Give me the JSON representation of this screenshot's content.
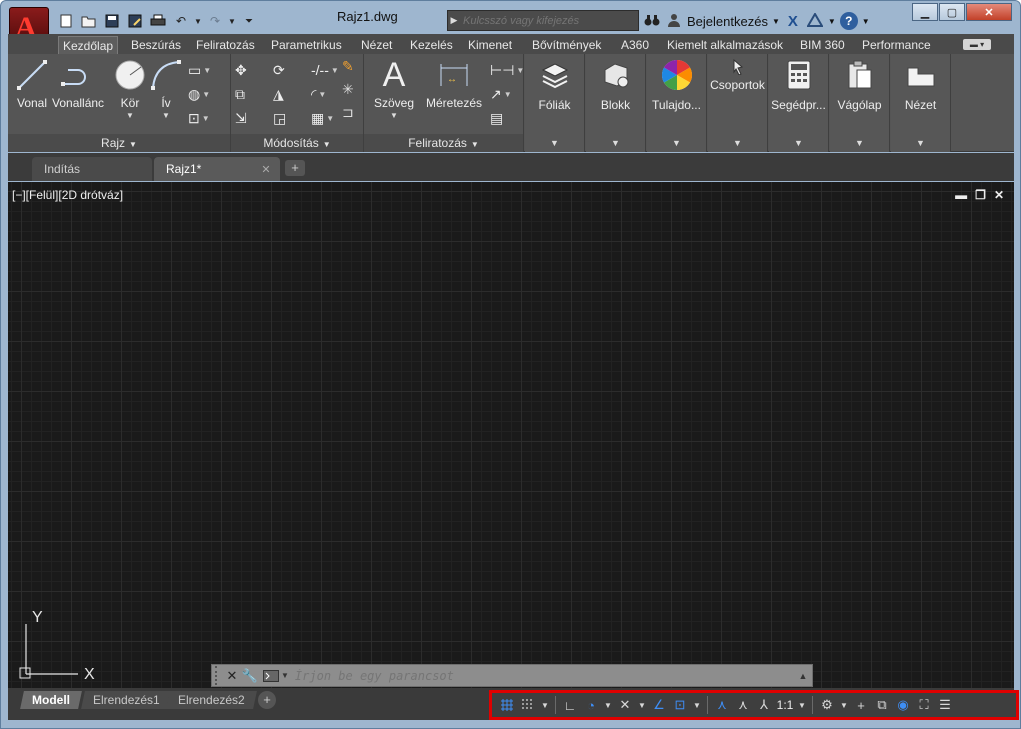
{
  "window": {
    "title": "Rajz1.dwg",
    "app_icon": "autocad-a-logo",
    "controls": [
      "minimize",
      "maximize",
      "close"
    ]
  },
  "quick_access": [
    "new-icon",
    "open-icon",
    "save-icon",
    "saveas-icon",
    "print-icon",
    "undo-icon",
    "redo-icon",
    "customize-icon"
  ],
  "search": {
    "placeholder": "Kulcsszó vagy kifejezés"
  },
  "account": {
    "signin_label": "Bejelentkezés"
  },
  "ribbon_tabs": [
    "Kezdőlap",
    "Beszúrás",
    "Feliratozás",
    "Parametrikus",
    "Nézet",
    "Kezelés",
    "Kimenet",
    "Bővítmények",
    "A360",
    "Kiemelt alkalmazások",
    "BIM 360",
    "Performance"
  ],
  "active_ribbon_tab": "Kezdőlap",
  "panels": {
    "draw": {
      "title": "Rajz",
      "tools": [
        "Vonal",
        "Vonallánc",
        "Kör",
        "Ív"
      ]
    },
    "modify": {
      "title": "Módosítás"
    },
    "annotation": {
      "title": "Feliratozás",
      "tools": [
        "Szöveg",
        "Méretezés"
      ]
    },
    "layers": {
      "label": "Fóliák"
    },
    "block": {
      "label": "Blokk"
    },
    "properties": {
      "label": "Tulajdo..."
    },
    "groups": {
      "label": "Csoportok"
    },
    "utilities": {
      "label": "Segédpr..."
    },
    "clipboard": {
      "label": "Vágólap"
    },
    "view": {
      "label": "Nézet"
    }
  },
  "file_tabs": {
    "start": "Indítás",
    "current": "Rajz1*"
  },
  "viewport": {
    "label": "[−][Felül][2D drótváz]",
    "ucs_y": "Y",
    "ucs_x": "X"
  },
  "command_line": {
    "placeholder": "Írjon be egy parancsot"
  },
  "layout_tabs": [
    "Modell",
    "Elrendezés1",
    "Elrendezés2"
  ],
  "status_bar": {
    "scale": "1:1",
    "tools": [
      "grid-icon",
      "snap-icon",
      "ortho-icon",
      "polar-icon",
      "isodraft-icon",
      "osnap-track-icon",
      "osnap-icon",
      "annotation-visibility-icon",
      "autoscale-icon",
      "annotation-scale-icon",
      "workspace-gear-icon",
      "plus-icon",
      "isolate-icon",
      "hardware-accel-icon",
      "fullscreen-icon",
      "menu-icon"
    ]
  },
  "colors": {
    "app_red": "#c41e1e",
    "status_highlight": "#e00000",
    "canvas_bg": "#1a1a1a",
    "accent_blue": "#3e8ef5"
  }
}
